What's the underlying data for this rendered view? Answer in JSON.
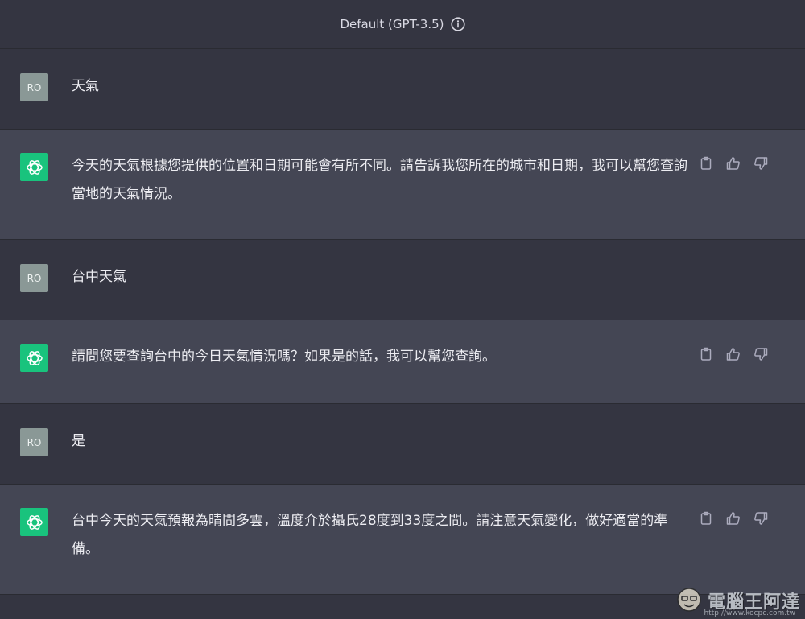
{
  "header": {
    "model_label": "Default (GPT-3.5)"
  },
  "user_avatar": "RO",
  "messages": [
    {
      "role": "user",
      "text": "天氣"
    },
    {
      "role": "assistant",
      "text": "今天的天氣根據您提供的位置和日期可能會有所不同。請告訴我您所在的城市和日期，我可以幫您查詢當地的天氣情況。"
    },
    {
      "role": "user",
      "text": "台中天氣"
    },
    {
      "role": "assistant",
      "text": "請問您要查詢台中的今日天氣情況嗎？如果是的話，我可以幫您查詢。"
    },
    {
      "role": "user",
      "text": "是"
    },
    {
      "role": "assistant",
      "text": "台中今天的天氣預報為晴間多雲，溫度介於攝氏28度到33度之間。請注意天氣變化，做好適當的準備。"
    }
  ],
  "icons": {
    "copy": "clipboard-icon",
    "like": "thumbs-up-icon",
    "dislike": "thumbs-down-icon",
    "info": "info-icon",
    "assistant_logo": "openai-logo-icon"
  },
  "colors": {
    "background": "#343541",
    "assistant_row": "#444654",
    "assistant_avatar": "#19c37d",
    "user_avatar": "#8a9896"
  },
  "watermark": {
    "text": "電腦王阿達",
    "url": "http://www.kocpc.com.tw"
  }
}
